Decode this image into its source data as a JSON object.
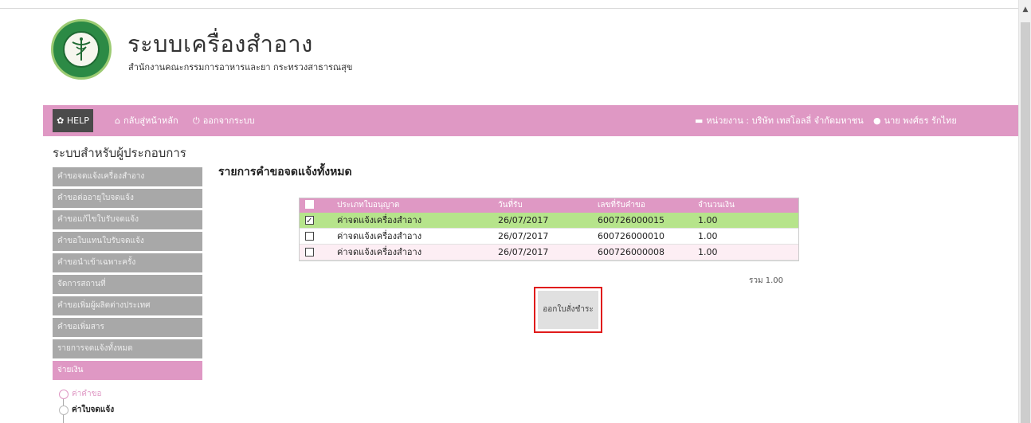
{
  "header": {
    "title": "ระบบเครื่องสำอาง",
    "subtitle": "สำนักงานคณะกรรมการอาหารและยา กระทรวงสาธารณสุข"
  },
  "navbar": {
    "help": "HELP",
    "home": "กลับสู่หน้าหลัก",
    "logout": "ออกจากระบบ",
    "agency": "หน่วยงาน : บริษัท เทสโอลลี่ จำกัดมหาชน",
    "user": "นาย พงศ์ธร รักไทย"
  },
  "sidebar": {
    "title": "ระบบสำหรับผู้ประกอบการ",
    "items": [
      {
        "label": "คำขอจดแจ้งเครื่องสำอาง"
      },
      {
        "label": "คำขอต่ออายุใบจดแจ้ง"
      },
      {
        "label": "คำขอแก้ไขใบรับจดแจ้ง"
      },
      {
        "label": "คำขอใบแทนใบรับจดแจ้ง"
      },
      {
        "label": "คำขอนำเข้าเฉพาะครั้ง"
      },
      {
        "label": "จัดการสถานที่"
      },
      {
        "label": "คำขอเพิ่มผู้ผลิตต่างประเทศ"
      },
      {
        "label": "คำขอเพิ่มสาร"
      },
      {
        "label": "รายการจดแจ้งทั้งหมด"
      },
      {
        "label": "จ่ายเงิน"
      }
    ],
    "sub_items": [
      {
        "label": "ค่าคำขอ"
      },
      {
        "label": "ค่าใบจดแจ้ง"
      }
    ]
  },
  "main": {
    "title": "รายการคำขอจดแจ้งทั้งหมด",
    "table": {
      "headers": [
        "ประเภทใบอนุญาต",
        "วันที่รับ",
        "เลขที่รับคำขอ",
        "จำนวนเงิน"
      ],
      "rows": [
        {
          "checked": true,
          "type": "ค่าจดแจ้งเครื่องสำอาง",
          "date": "26/07/2017",
          "number": "600726000015",
          "amount": "1.00"
        },
        {
          "checked": false,
          "type": "ค่าจดแจ้งเครื่องสำอาง",
          "date": "26/07/2017",
          "number": "600726000010",
          "amount": "1.00"
        },
        {
          "checked": false,
          "type": "ค่าจดแจ้งเครื่องสำอาง",
          "date": "26/07/2017",
          "number": "600726000008",
          "amount": "1.00"
        }
      ],
      "total": "รวม 1.00"
    },
    "pay_button": "ออกใบสั่งชำระ"
  },
  "colors": {
    "nav_pink": "#df98c4",
    "selected_row": "#b6e48b",
    "highlight_border": "#e01b1b",
    "sidebar_gray": "#a8a8a8"
  }
}
